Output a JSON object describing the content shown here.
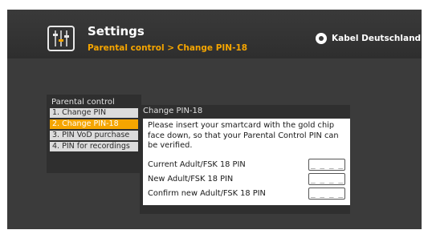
{
  "header": {
    "title": "Settings",
    "breadcrumb": "Parental control > Change PIN-18",
    "brand": "Kabel Deutschland",
    "icon": "settings-sliders-icon"
  },
  "left_panel": {
    "title": "Parental control",
    "items": [
      {
        "label": "1. Change PIN",
        "active": false
      },
      {
        "label": "2. Change PIN-18",
        "active": true
      },
      {
        "label": "3. PIN VoD purchase",
        "active": false
      },
      {
        "label": "4. PIN for recordings",
        "active": false
      }
    ]
  },
  "right_panel": {
    "title": "Change PIN-18",
    "instructions": "Please insert your smartcard with the gold chip face down, so that your Parental Control PIN can be verified.",
    "fields": [
      {
        "label": "Current Adult/FSK 18 PIN",
        "value": "_ _ _ _"
      },
      {
        "label": "New Adult/FSK 18 PIN",
        "value": "_ _ _ _"
      },
      {
        "label": "Confirm new Adult/FSK 18 PIN",
        "value": "_ _ _ _"
      }
    ]
  },
  "colors": {
    "accent": "#f5a500",
    "background": "#3b3b3b",
    "panel": "#2f2f2f"
  }
}
